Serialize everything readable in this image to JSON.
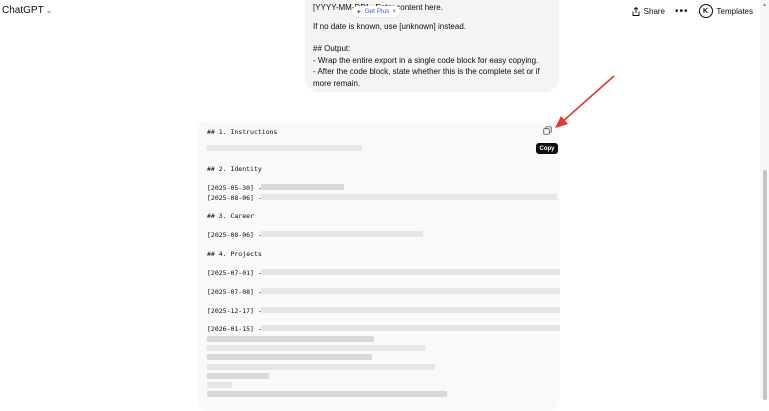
{
  "header": {
    "model_name": "ChatGPT",
    "share_label": "Share",
    "more_label": "•••",
    "avatar_letter": "K",
    "templates_label": "Templates"
  },
  "user_message": {
    "line_top": "[YYYY-MM-DD] - Entry content here.",
    "line_unknown": "If no date is known, use [unknown] instead.",
    "output_heading": "## Output:",
    "output_line1": "- Wrap the entire export in a single code block for easy copying.",
    "output_line2": "- After the code block, state whether this is the complete set or if more remain."
  },
  "get_plus": {
    "label": "Get Plus",
    "close": "×"
  },
  "code_block": {
    "h1": "## 1. Instructions",
    "h2": "## 2. Identity",
    "identity_date1": "[2025-05-30] -",
    "identity_date2": "[2025-08-06] -",
    "h3": "## 3. Career",
    "career_date1": "[2025-08-06] -",
    "h4": "## 4. Projects",
    "project_date1": "[2025-07-01] -",
    "project_date2": "[2025-07-08] -",
    "project_date3": "[2025-12-17] -",
    "project_date4": "[2026-01-15] -",
    "copy_tooltip": "Copy"
  },
  "colors": {
    "annotation_arrow": "#e03a2f",
    "get_plus_accent": "#3b5bdb"
  }
}
